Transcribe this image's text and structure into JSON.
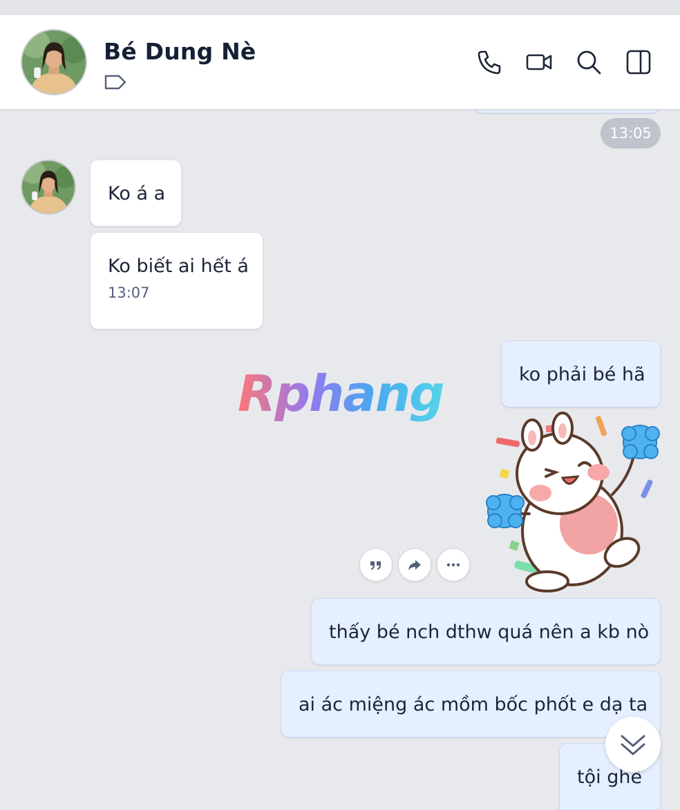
{
  "header": {
    "contact_name": "Bé Dung Nè",
    "icons": [
      "phone-icon",
      "video-call-icon",
      "search-icon",
      "sidebar-toggle-icon"
    ]
  },
  "prev_message_time": "13:05",
  "messages": [
    {
      "sender": "contact",
      "text": "Ko á a"
    },
    {
      "sender": "contact",
      "text": "Ko biết ai hết á",
      "time": "13:07"
    },
    {
      "sender": "me",
      "text": "ko phải bé hã"
    },
    {
      "sender": "me",
      "type": "sticker",
      "sticker": "cheering-bunny-sticker"
    },
    {
      "sender": "me",
      "text": "thấy bé nch dthw quá nên a kb nò"
    },
    {
      "sender": "me",
      "text": "ai ác miệng ác mồm bốc phốt e dạ ta"
    },
    {
      "sender": "me",
      "text": "tội ghê"
    }
  ],
  "message_actions": {
    "quote": "quote-icon",
    "forward": "forward-icon",
    "more": "more-icon"
  },
  "watermark": "Rphang"
}
